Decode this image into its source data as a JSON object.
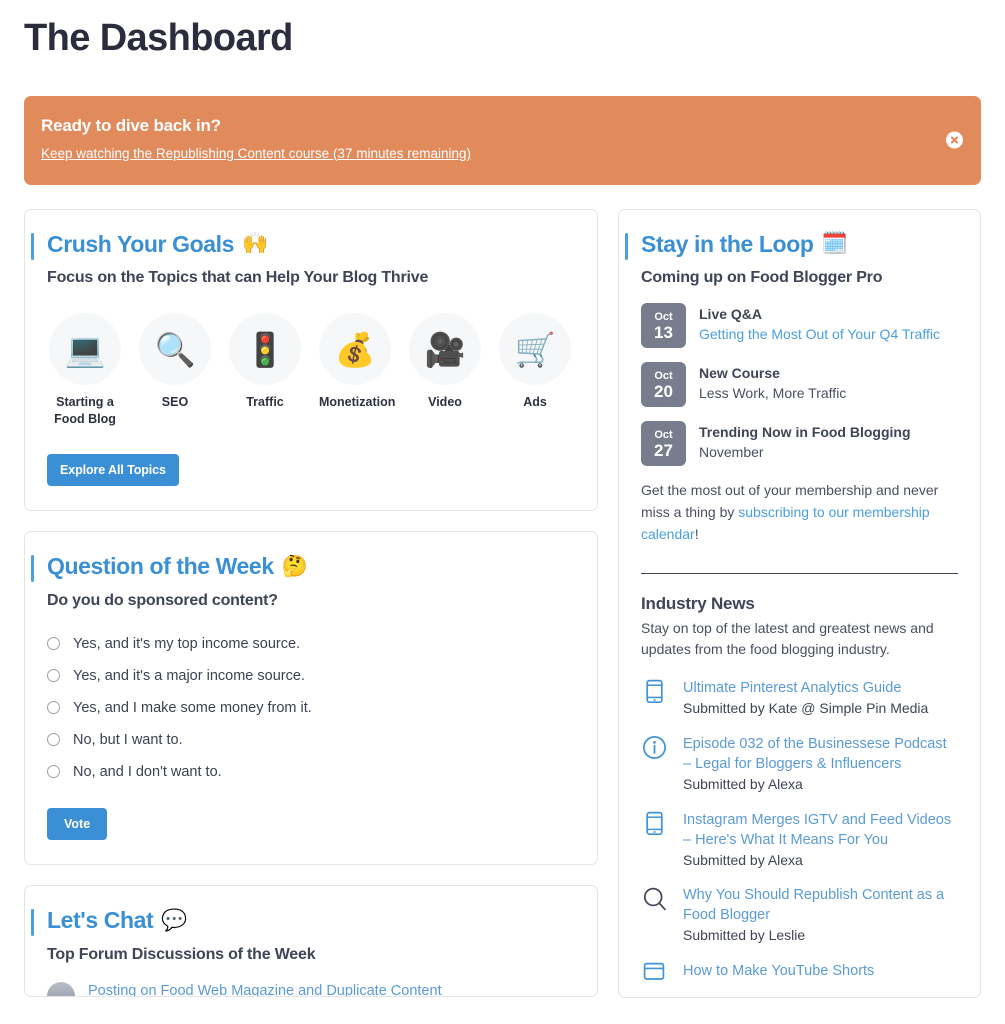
{
  "page": {
    "title": "The Dashboard"
  },
  "banner": {
    "title": "Ready to dive back in?",
    "link": "Keep watching the Republishing Content course (37 minutes remaining)",
    "close_icon": "close-circle-icon",
    "bg_color": "#E18A5C"
  },
  "goals": {
    "title": "Crush Your Goals",
    "title_emoji": "🙌",
    "subtitle": "Focus on the Topics that can Help Your Blog Thrive",
    "topics": [
      {
        "label": "Starting a Food Blog",
        "emoji": "💻",
        "icon": "laptop-icon"
      },
      {
        "label": "SEO",
        "emoji": "🔍",
        "icon": "magnifier-icon"
      },
      {
        "label": "Traffic",
        "emoji": "🚦",
        "icon": "traffic-light-icon"
      },
      {
        "label": "Monetization",
        "emoji": "💰",
        "icon": "money-bag-icon"
      },
      {
        "label": "Video",
        "emoji": "🎥",
        "icon": "movie-camera-icon"
      },
      {
        "label": "Ads",
        "emoji": "🛒",
        "icon": "shopping-cart-icon"
      }
    ],
    "button": "Explore All Topics"
  },
  "question": {
    "title": "Question of the Week",
    "title_emoji": "🤔",
    "prompt": "Do you do sponsored content?",
    "options": [
      "Yes, and it's my top income source.",
      "Yes, and it's a major income source.",
      "Yes, and I make some money from it.",
      "No, but I want to.",
      "No, and I don't want to."
    ],
    "button": "Vote"
  },
  "chat": {
    "title": "Let's Chat",
    "title_emoji": "💬",
    "subtitle": "Top Forum Discussions of the Week",
    "threads": [
      "Posting on Food Web Magazine and Duplicate Content"
    ]
  },
  "loop": {
    "title": "Stay in the Loop",
    "title_emoji": "🗓️",
    "subtitle": "Coming up on Food Blogger Pro",
    "events": [
      {
        "month": "Oct",
        "day": "13",
        "title": "Live Q&A",
        "detail": "Getting the Most Out of Your Q4 Traffic",
        "detail_is_link": true
      },
      {
        "month": "Oct",
        "day": "20",
        "title": "New Course",
        "detail": "Less Work, More Traffic",
        "detail_is_link": false
      },
      {
        "month": "Oct",
        "day": "27",
        "title": "Trending Now in Food Blogging",
        "detail": "November",
        "detail_is_link": false
      }
    ],
    "note_prefix": "Get the most out of your membership and never miss a thing by ",
    "note_link": "subscribing to our membership calendar",
    "note_suffix": "!"
  },
  "news": {
    "title": "Industry News",
    "subtitle": "Stay on top of the latest and greatest news and updates from the food blogging industry.",
    "items": [
      {
        "icon": "mobile-phone-icon",
        "headline": "Ultimate Pinterest Analytics Guide",
        "meta": "Submitted by Kate @ Simple Pin Media"
      },
      {
        "icon": "info-circle-icon",
        "headline": "Episode 032 of the Businessese Podcast – Legal for Bloggers & Influencers",
        "meta": "Submitted by Alexa"
      },
      {
        "icon": "mobile-phone-icon",
        "headline": "Instagram Merges IGTV and Feed Videos – Here's What It Means For You",
        "meta": "Submitted by Alexa"
      },
      {
        "icon": "magnifier-icon",
        "headline": "Why You Should Republish Content as a Food Blogger",
        "meta": "Submitted by Leslie"
      },
      {
        "icon": "browser-window-icon",
        "headline": "How to Make YouTube Shorts",
        "meta": ""
      }
    ]
  },
  "colors": {
    "accent_blue": "#3B8FD4",
    "link_blue": "#5B9BD5",
    "banner_orange": "#E18A5C",
    "badge_gray": "#777D8C",
    "heading_dark": "#2B2D3C"
  }
}
